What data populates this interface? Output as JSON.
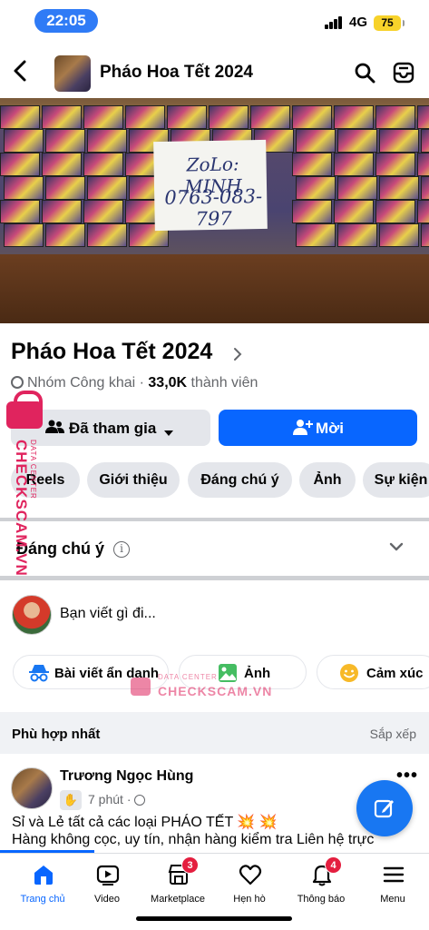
{
  "status_bar": {
    "time": "22:05",
    "network": "4G",
    "battery": "75"
  },
  "header": {
    "title": "Pháo Hoa Tết 2024"
  },
  "cover": {
    "sign_line1": "ZoLo: MINH",
    "sign_line2": "0763-083-797"
  },
  "group": {
    "name": "Pháo Hoa Tết 2024",
    "privacy": "Nhóm Công khai",
    "separator": " · ",
    "member_count": "33,0K",
    "member_suffix": "thành viên"
  },
  "actions": {
    "joined_label": "Đã tham gia",
    "invite_label": "Mời"
  },
  "tabs": [
    "Reels",
    "Giới thiệu",
    "Đáng chú ý",
    "Ảnh",
    "Sự kiện"
  ],
  "featured": {
    "title": "Đáng chú ý",
    "info": "i"
  },
  "composer": {
    "placeholder": "Bạn viết gì đi..."
  },
  "composer_chips": [
    {
      "label": "Bài viết ẩn danh",
      "icon": "incognito-icon"
    },
    {
      "label": "Ảnh",
      "icon": "photo-icon"
    },
    {
      "label": "Cảm xúc",
      "icon": "smiley-icon"
    }
  ],
  "sort": {
    "left": "Phù hợp nhất",
    "right": "Sắp xếp"
  },
  "post": {
    "author": "Trương Ngọc Hùng",
    "time": "7 phút",
    "separator": " · ",
    "line1": "Sỉ và Lẻ tất cả các loại PHÁO TẾT 💥 💥",
    "line2": "Hàng không cọc, uy tín, nhận hàng kiểm tra Liên hệ trực"
  },
  "bottom_nav": [
    {
      "label": "Trang chủ",
      "icon": "home-icon",
      "active": true
    },
    {
      "label": "Video",
      "icon": "video-icon"
    },
    {
      "label": "Marketplace",
      "icon": "marketplace-icon",
      "badge": "3"
    },
    {
      "label": "Hẹn hò",
      "icon": "heart-icon"
    },
    {
      "label": "Thông báo",
      "icon": "bell-icon",
      "badge": "4"
    },
    {
      "label": "Menu",
      "icon": "menu-icon"
    }
  ],
  "watermark": {
    "brand": "CHECKSCAM.VN",
    "sub": "DATA CENTER"
  },
  "colors": {
    "accent": "#0866ff",
    "badge": "#e41e3f",
    "watermark": "#e0245e"
  }
}
